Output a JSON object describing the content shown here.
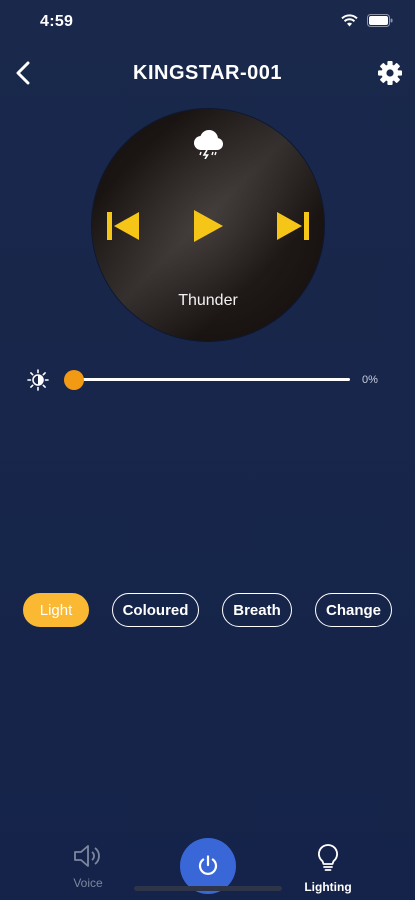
{
  "status_bar": {
    "time": "4:59"
  },
  "header": {
    "title": "KINGSTAR-001"
  },
  "player": {
    "track_name": "Thunder"
  },
  "brightness": {
    "level": 0,
    "label": "0%"
  },
  "modes": [
    {
      "label": "Light",
      "active": true
    },
    {
      "label": "Coloured",
      "active": false
    },
    {
      "label": "Breath",
      "active": false
    },
    {
      "label": "Change",
      "active": false
    }
  ],
  "bottom_nav": {
    "voice_label": "Voice",
    "lighting_label": "Lighting"
  },
  "colors": {
    "background": "#162447",
    "accent": "#fbb933",
    "control_yellow": "#f5c518",
    "slider_thumb": "#f39a15",
    "power_button": "#3a67d8"
  },
  "icons": [
    "back-icon",
    "settings-gear-icon",
    "thunderstorm-cloud-icon",
    "previous-icon",
    "play-icon",
    "next-icon",
    "brightness-icon",
    "speaker-icon",
    "power-icon",
    "lightbulb-icon"
  ]
}
